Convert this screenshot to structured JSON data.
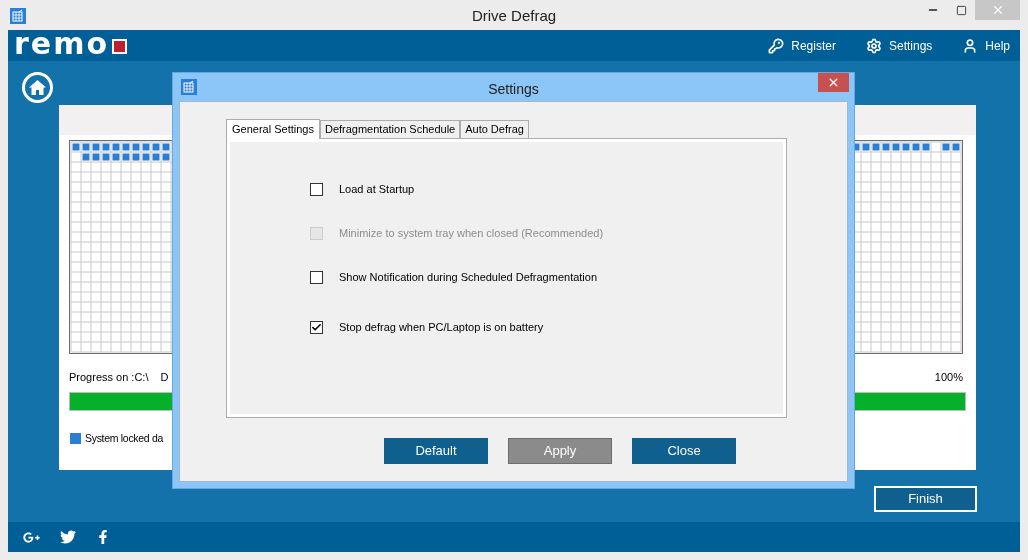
{
  "window": {
    "title": "Drive Defrag"
  },
  "header": {
    "logo": "remo",
    "nav": [
      {
        "kind": "register",
        "label": "Register"
      },
      {
        "kind": "settings",
        "label": "Settings"
      },
      {
        "kind": "help",
        "label": "Help"
      }
    ]
  },
  "progress": {
    "label": "Progress on :C:\\",
    "column_2": "D",
    "percent": "100%",
    "level": 1
  },
  "legend": [
    {
      "label": "System locked da",
      "color": "#2a7fd4"
    }
  ],
  "finish_button": "Finish",
  "dialog": {
    "title": "Settings",
    "tabs": [
      {
        "label": "General Settings",
        "selected": true
      },
      {
        "label": "Defragmentation Schedule",
        "selected": false
      },
      {
        "label": "Auto Defrag",
        "selected": false
      }
    ],
    "options": [
      {
        "label": "Load at Startup",
        "checked": false,
        "disabled": false
      },
      {
        "label": "Minimize to system tray when closed (Recommended)",
        "checked": false,
        "disabled": true
      },
      {
        "label": "Show Notification during Scheduled Defragmentation",
        "checked": false,
        "disabled": false
      },
      {
        "label": "Stop defrag when PC/Laptop is on battery",
        "checked": true,
        "disabled": false
      }
    ],
    "buttons": [
      {
        "label": "Default",
        "disabled": false
      },
      {
        "label": "Apply",
        "disabled": true
      },
      {
        "label": "Close",
        "disabled": false
      }
    ]
  },
  "footer": {
    "social": [
      {
        "kind": "googleplus"
      },
      {
        "kind": "twitter"
      },
      {
        "kind": "facebook"
      }
    ]
  }
}
